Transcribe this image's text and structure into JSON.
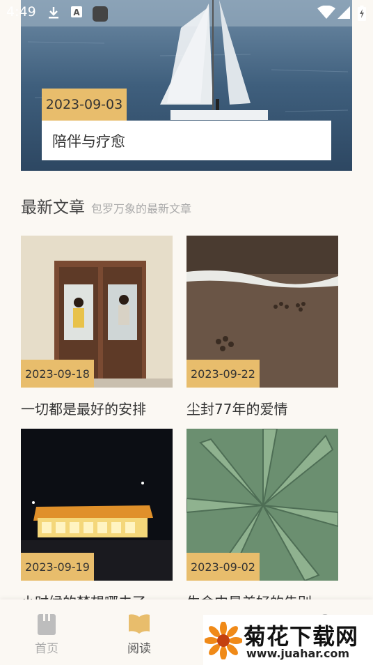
{
  "status_bar": {
    "time": "4:49",
    "icons": [
      "download-icon",
      "keyboard-a-icon",
      "app-square-icon",
      "wifi-icon",
      "signal-icon",
      "battery-charging-icon"
    ]
  },
  "hero": {
    "date": "2023-09-03",
    "title": "陪伴与疗愈",
    "image": "sailboat-on-sea"
  },
  "section": {
    "title": "最新文章",
    "subtitle": "包罗万象的最新文章"
  },
  "articles": [
    {
      "date": "2023-09-18",
      "title": "一切都是最好的安排",
      "image": "couple-in-doorway"
    },
    {
      "date": "2023-09-22",
      "title": "尘封77年的爱情",
      "image": "paw-prints-on-beach"
    },
    {
      "date": "2023-09-19",
      "title": "小时候的梦想哪去了",
      "image": "waffle-house-at-night"
    },
    {
      "date": "2023-09-02",
      "title": "生命中最美好的告别",
      "image": "aloe-plant"
    }
  ],
  "tabbar": {
    "tabs": [
      {
        "label": "首页",
        "icon": "book-spine-icon",
        "active": false
      },
      {
        "label": "阅读",
        "icon": "open-book-icon",
        "active": true
      },
      {
        "label": "",
        "icon": "document-icon",
        "active": false
      },
      {
        "label": "",
        "icon": "profile-icon",
        "active": false
      }
    ]
  },
  "watermark": {
    "name": "菊花下载网",
    "url": "www.juahar.com"
  },
  "colors": {
    "accent": "#e8bd6c",
    "background": "#fbf8f3",
    "text": "#333333"
  }
}
